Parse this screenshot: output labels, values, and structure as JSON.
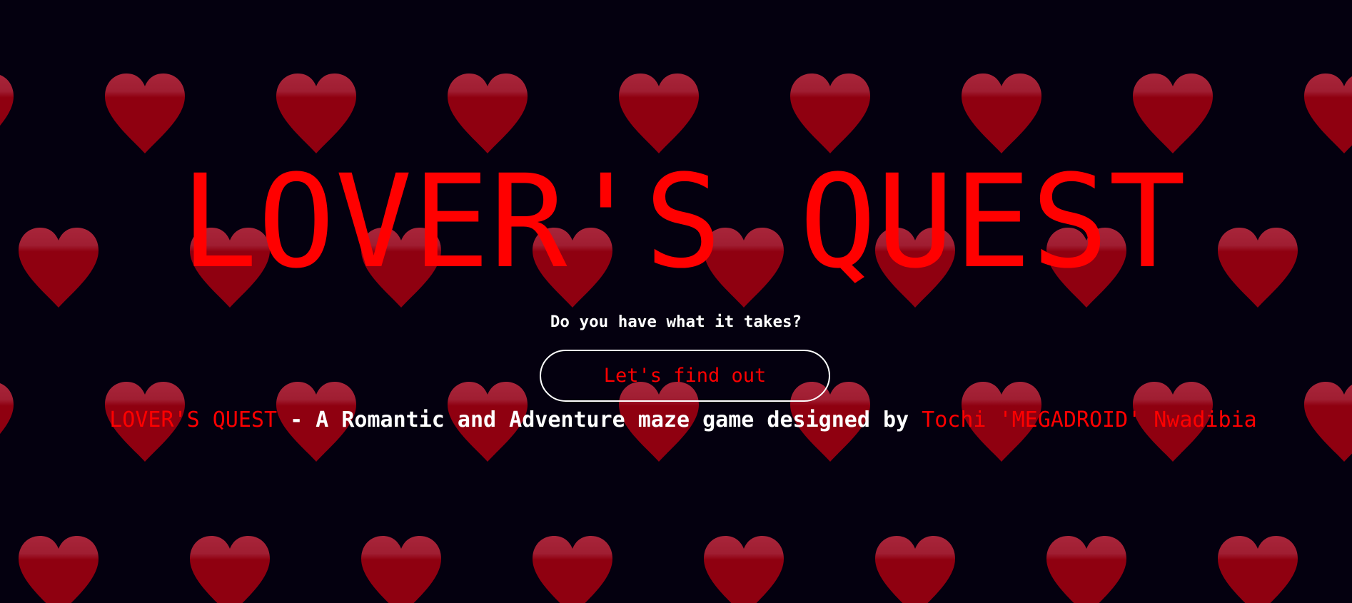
{
  "colors": {
    "background": "#04000f",
    "accent": "#ff0000",
    "heart": "#8f0010",
    "heart_highlight": "#a8253a",
    "text": "#ffffff"
  },
  "background_icon": "heart-icon",
  "hero": {
    "title": "LOVER'S QUEST",
    "subtitle": "Do you have what it takes?",
    "cta_label": "Let's find out"
  },
  "footer": {
    "game_name": "LOVER'S QUEST",
    "description": " - A Romantic and Adventure maze game designed by ",
    "author": "Tochi 'MEGADROID' Nwadibia"
  }
}
